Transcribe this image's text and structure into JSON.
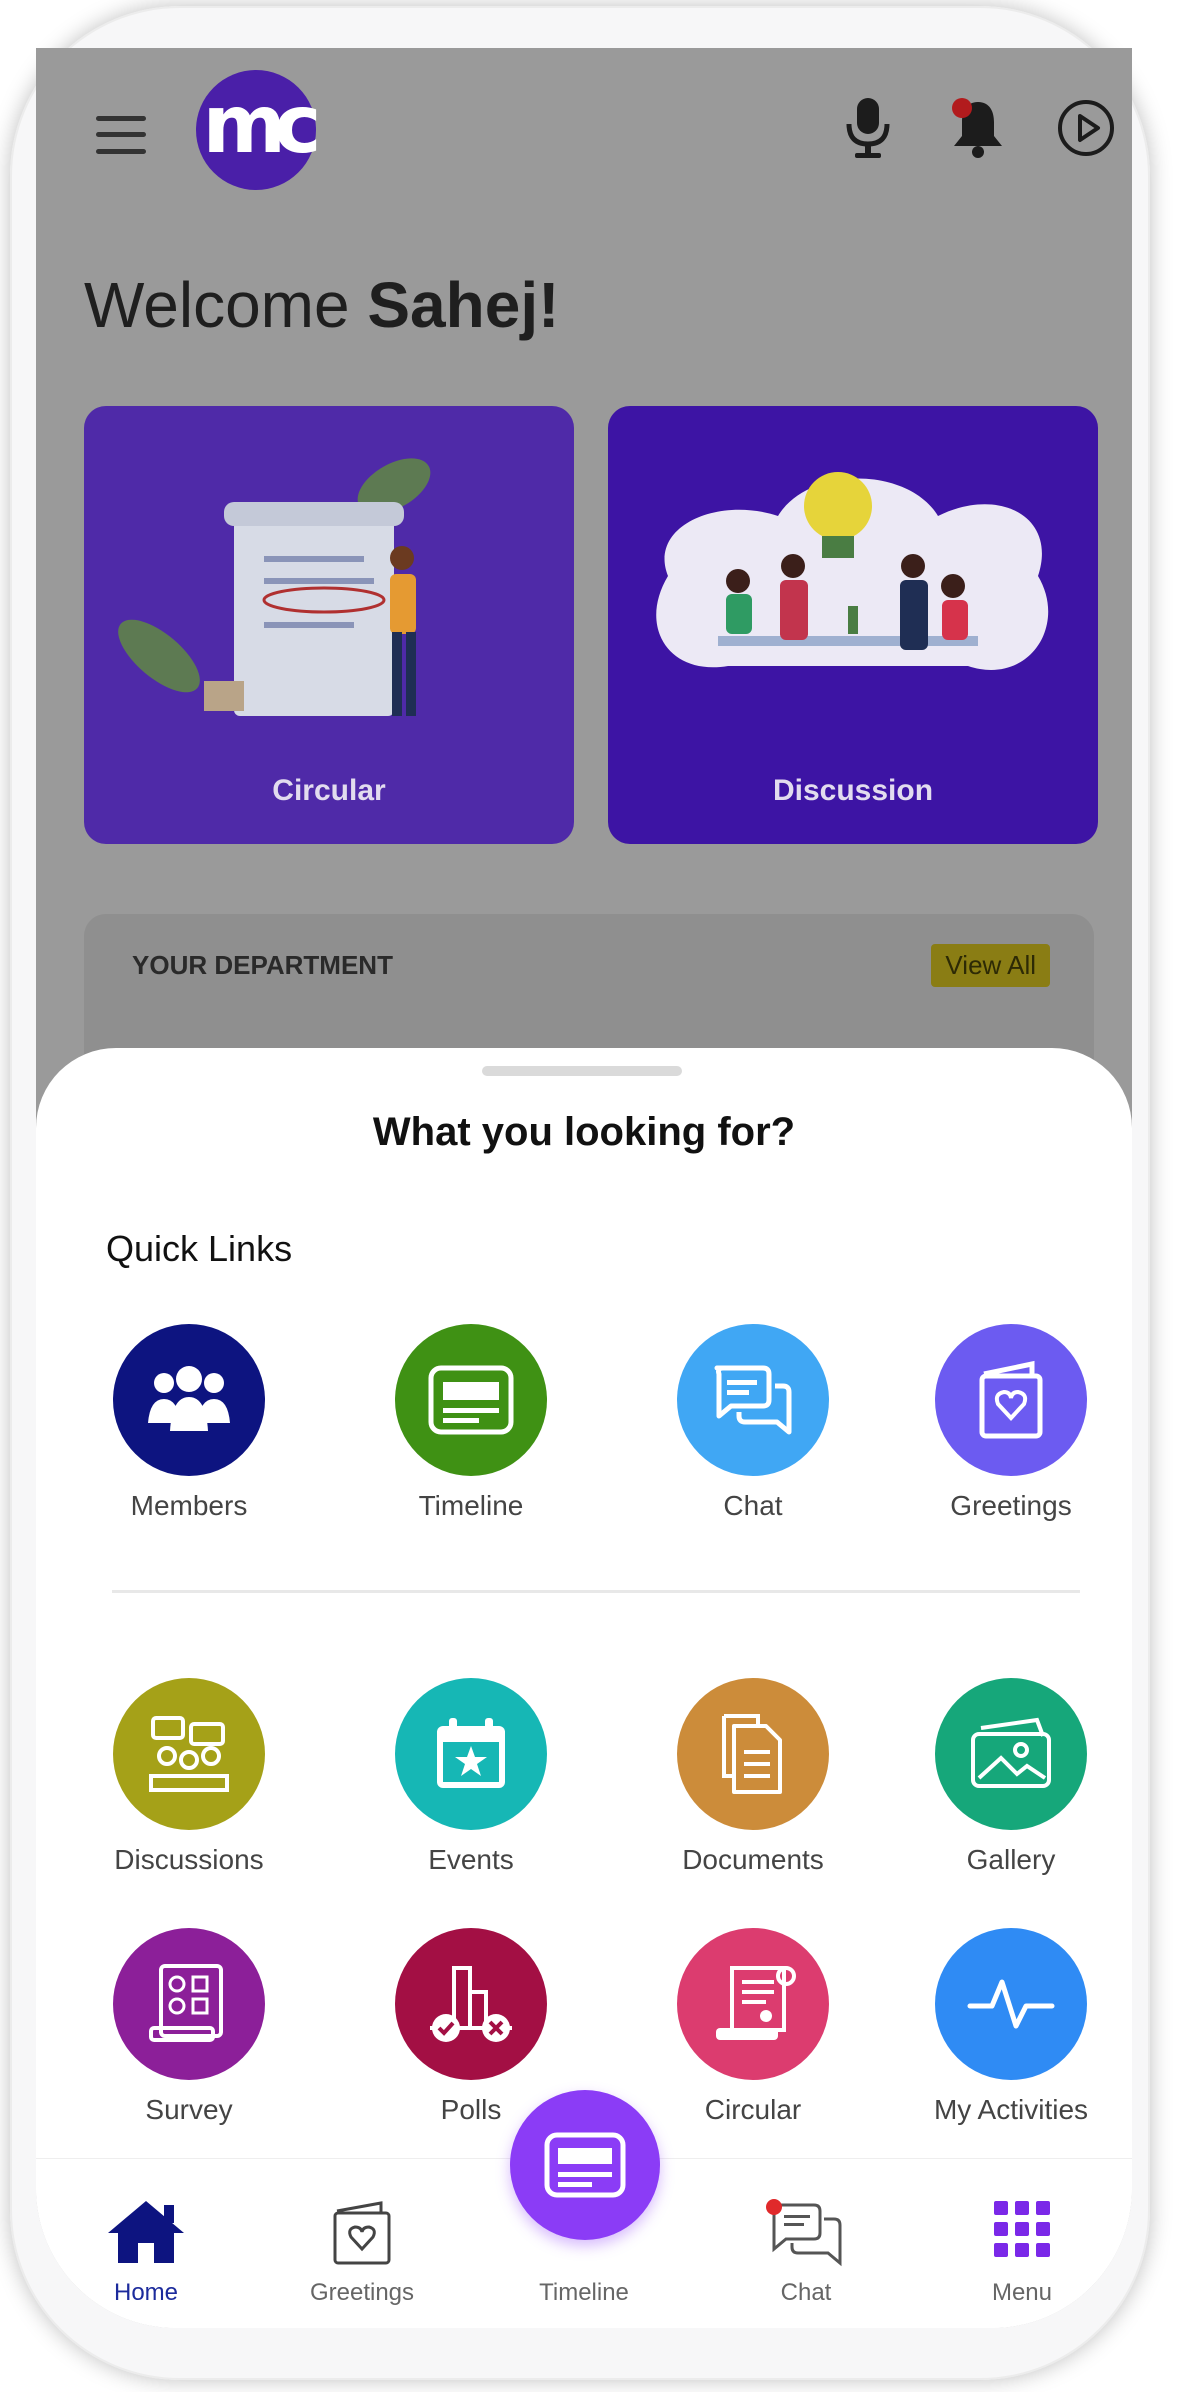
{
  "header": {
    "logo_text": "mc",
    "welcome_prefix": "Welcome ",
    "user_name": "Sahej!"
  },
  "cards": [
    {
      "label": "Circular",
      "color": "#4f2aa8"
    },
    {
      "label": "Discussion",
      "color": "#3d14a4"
    }
  ],
  "department": {
    "title": "YOUR DEPARTMENT",
    "view_all": "View All"
  },
  "sheet": {
    "title": "What you looking for?",
    "quick_links_title": "Quick Links",
    "quick_links": [
      {
        "label": "Members",
        "icon": "members-icon",
        "color": "#0d1480"
      },
      {
        "label": "Timeline",
        "icon": "timeline-icon",
        "color": "#3f9114"
      },
      {
        "label": "Chat",
        "icon": "chat-icon",
        "color": "#40a7f4"
      },
      {
        "label": "Greetings",
        "icon": "greeting-card-icon",
        "color": "#6c5bf1"
      }
    ],
    "more_links": [
      {
        "label": "Discussions",
        "icon": "discussions-icon",
        "color": "#a5a118"
      },
      {
        "label": "Events",
        "icon": "calendar-star-icon",
        "color": "#16b7b5"
      },
      {
        "label": "Documents",
        "icon": "documents-icon",
        "color": "#cc8c3a"
      },
      {
        "label": "Gallery",
        "icon": "gallery-icon",
        "color": "#16a77a"
      },
      {
        "label": "Survey",
        "icon": "survey-icon",
        "color": "#8c1f99"
      },
      {
        "label": "Polls",
        "icon": "polls-icon",
        "color": "#a30f44"
      },
      {
        "label": "Circular",
        "icon": "circular-scroll-icon",
        "color": "#dc3c6f"
      },
      {
        "label": "My Activities",
        "icon": "activity-pulse-icon",
        "color": "#2f8bf4"
      }
    ]
  },
  "bottom_nav": [
    {
      "label": "Home",
      "icon": "home-icon",
      "active": true
    },
    {
      "label": "Greetings",
      "icon": "greeting-card-icon"
    },
    {
      "label": "Timeline",
      "icon": "timeline-icon"
    },
    {
      "label": "Chat",
      "icon": "chat-icon",
      "badge": true
    },
    {
      "label": "Menu",
      "icon": "grid-menu-icon"
    }
  ],
  "colors": {
    "accent": "#8b3cf6",
    "active_nav": "#1c2b9c",
    "badge": "#e0292b"
  }
}
